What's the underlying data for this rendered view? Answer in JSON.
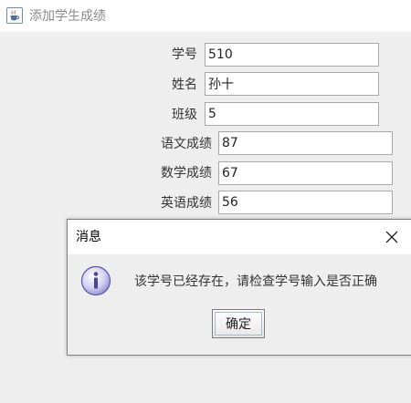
{
  "window": {
    "title": "添加学生成绩",
    "icon": "java-cup-icon"
  },
  "form": {
    "fields": [
      {
        "label": "学号",
        "value": "510"
      },
      {
        "label": "姓名",
        "value": "孙十"
      },
      {
        "label": "班级",
        "value": "5"
      },
      {
        "label": "语文成绩",
        "value": "87"
      },
      {
        "label": "数学成绩",
        "value": "67"
      },
      {
        "label": "英语成绩",
        "value": "56"
      }
    ]
  },
  "dialog": {
    "title": "消息",
    "icon": "info-icon",
    "message": "该学号已经存在，请检查学号输入是否正确",
    "ok_label": "确定",
    "close_icon": "close-icon"
  }
}
